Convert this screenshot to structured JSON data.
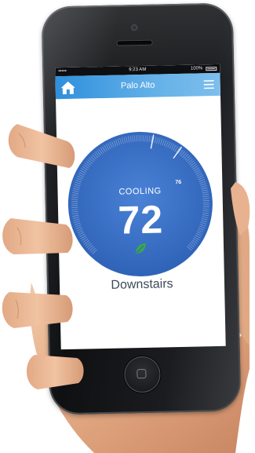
{
  "status_bar": {
    "carrier": "••••• ",
    "time": "9:23 AM",
    "battery": "100%"
  },
  "app_bar": {
    "title": "Palo Alto",
    "home_icon": "home-icon",
    "menu_icon": "menu-icon"
  },
  "thermostat": {
    "mode": "COOLING",
    "current_temp": "72",
    "target_temp": "76",
    "dial_color": "#3a6fc4",
    "eco_icon": "leaf-icon",
    "eco_color": "#3aa84a"
  },
  "room": {
    "name": "Downstairs"
  }
}
